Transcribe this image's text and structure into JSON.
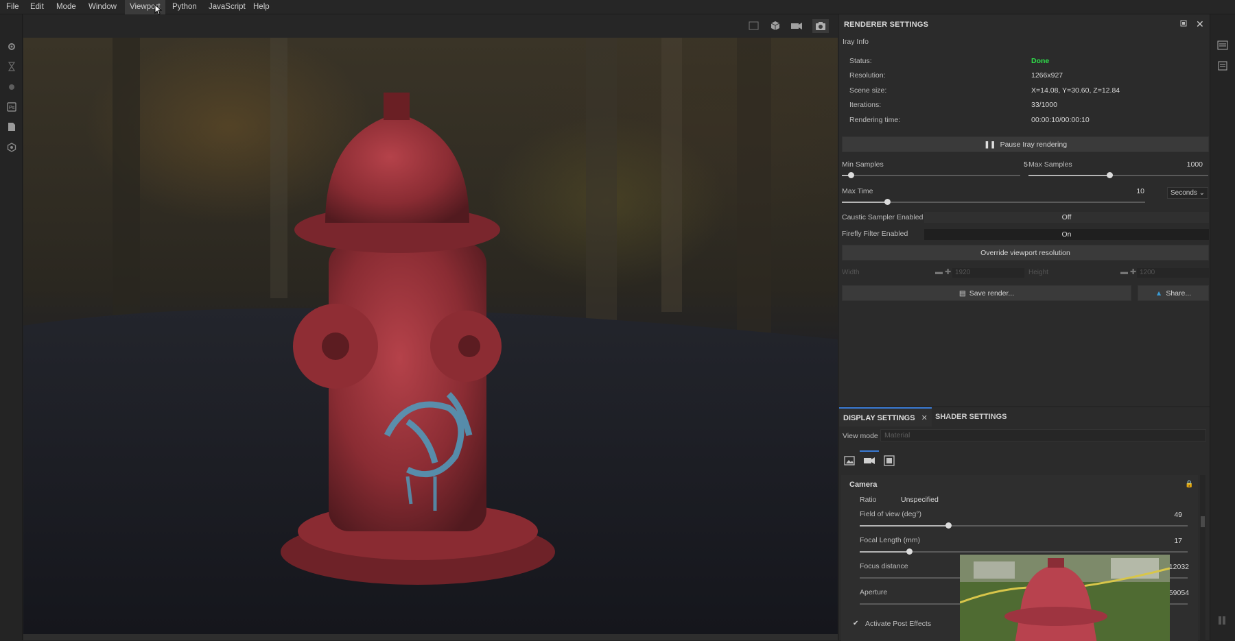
{
  "menubar": {
    "items": [
      "File",
      "Edit",
      "Mode",
      "Window",
      "Viewport",
      "Python",
      "JavaScript",
      "Help"
    ],
    "active": "Viewport"
  },
  "renderer": {
    "title": "RENDERER SETTINGS",
    "section": "Iray Info",
    "info": [
      {
        "label": "Status:",
        "value": "Done"
      },
      {
        "label": "Resolution:",
        "value": "1266x927"
      },
      {
        "label": "Scene size:",
        "value": "X=14.08, Y=30.60, Z=12.84"
      },
      {
        "label": "Iterations:",
        "value": "33/1000"
      },
      {
        "label": "Rendering time:",
        "value": "00:00:10/00:00:10"
      }
    ],
    "status_color": "#2ee04a",
    "pause_label": "Pause Iray rendering",
    "min_samples": {
      "label": "Min Samples",
      "value": "5",
      "fraction": 0.05
    },
    "max_samples": {
      "label": "Max Samples",
      "value": "1000",
      "fraction": 0.45
    },
    "max_time": {
      "label": "Max Time",
      "value": "10",
      "fraction": 0.15,
      "unit": "Seconds"
    },
    "caustic": {
      "label": "Caustic Sampler Enabled",
      "value": "Off"
    },
    "firefly": {
      "label": "Firefly Filter Enabled",
      "value": "On"
    },
    "override_label": "Override viewport resolution",
    "width": {
      "label": "Width",
      "value": "1920"
    },
    "height": {
      "label": "Height",
      "value": "1200"
    },
    "save_label": "Save render...",
    "share_label": "Share..."
  },
  "display": {
    "tabs": [
      {
        "label": "DISPLAY SETTINGS",
        "active": true
      },
      {
        "label": "SHADER SETTINGS",
        "active": false
      }
    ],
    "view_mode_label": "View mode",
    "view_mode_value": "Material",
    "camera": {
      "title": "Camera",
      "ratio_label": "Ratio",
      "ratio_value": "Unspecified",
      "fov": {
        "label": "Field of view (deg°)",
        "value": "49",
        "fraction": 0.27
      },
      "focal": {
        "label": "Focal Length (mm)",
        "value": "17",
        "fraction": 0.15
      },
      "focus": {
        "label": "Focus distance",
        "value": "12032"
      },
      "aperture": {
        "label": "Aperture",
        "value": "59054"
      },
      "post_effects": "Activate Post Effects"
    }
  },
  "accent_color": "#3a7bd5"
}
